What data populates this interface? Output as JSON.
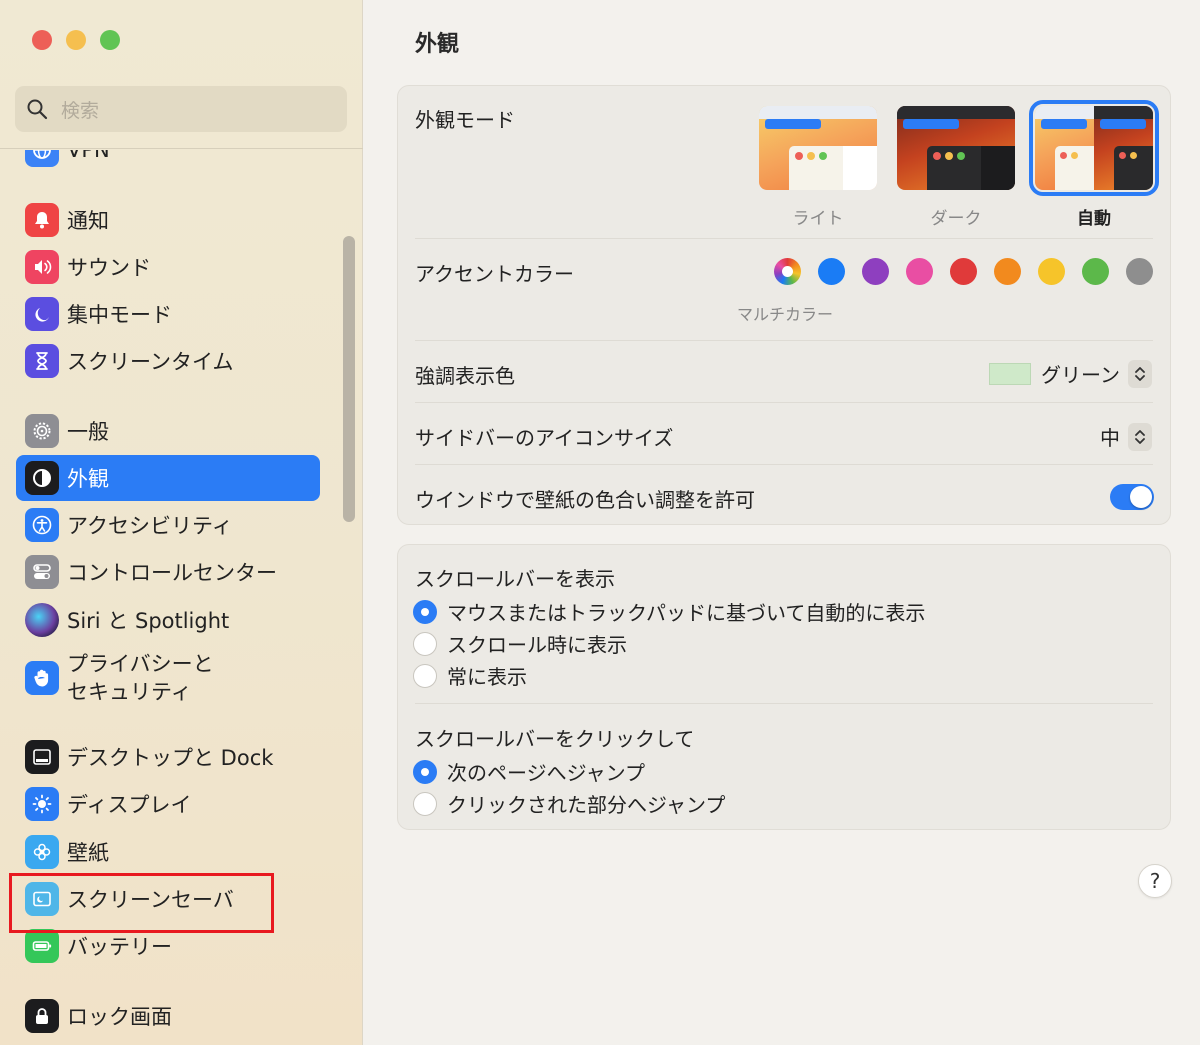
{
  "window": {
    "title": "外観"
  },
  "search": {
    "placeholder": "検索"
  },
  "sidebar": {
    "items": [
      {
        "label": "VPN",
        "icon": "globe-icon",
        "color": "#3b82f6"
      },
      {
        "label": "通知",
        "icon": "bell-icon",
        "color": "#ef4444"
      },
      {
        "label": "サウンド",
        "icon": "speaker-icon",
        "color": "#ef4461"
      },
      {
        "label": "集中モード",
        "icon": "moon-icon",
        "color": "#5b4ee0"
      },
      {
        "label": "スクリーンタイム",
        "icon": "hourglass-icon",
        "color": "#5b4ee0"
      },
      {
        "label": "一般",
        "icon": "gear-icon",
        "color": "#8e8e93"
      },
      {
        "label": "外観",
        "icon": "appearance-icon",
        "color": "#1c1c1e"
      },
      {
        "label": "アクセシビリティ",
        "icon": "accessibility-icon",
        "color": "#2b7cf5"
      },
      {
        "label": "コントロールセンター",
        "icon": "toggles-icon",
        "color": "#8e8e93"
      },
      {
        "label": "Siri と Spotlight",
        "icon": "siri-icon",
        "color": "#6b3fa0"
      },
      {
        "label": "プライバシーと\nセキュリティ",
        "icon": "hand-icon",
        "color": "#2b7cf5"
      },
      {
        "label": "デスクトップと Dock",
        "icon": "dock-icon",
        "color": "#1c1c1e"
      },
      {
        "label": "ディスプレイ",
        "icon": "brightness-icon",
        "color": "#2b7cf5"
      },
      {
        "label": "壁紙",
        "icon": "flower-icon",
        "color": "#3aa8f0"
      },
      {
        "label": "スクリーンセーバ",
        "icon": "screensaver-icon",
        "color": "#4fb6e8"
      },
      {
        "label": "バッテリー",
        "icon": "battery-icon",
        "color": "#34c759"
      },
      {
        "label": "ロック画面",
        "icon": "lock-icon",
        "color": "#1c1c1e"
      }
    ]
  },
  "appearance": {
    "mode_label": "外観モード",
    "modes": [
      {
        "label": "ライト"
      },
      {
        "label": "ダーク"
      },
      {
        "label": "自動"
      }
    ],
    "selected_mode": "自動",
    "accent_label": "アクセントカラー",
    "accent_colors": [
      "multicolor",
      "#1a7cf5",
      "#8e3fbf",
      "#e94ea3",
      "#e03a3a",
      "#f28a1e",
      "#f6c42a",
      "#5cb84a",
      "#8e8e8e"
    ],
    "accent_selected_label": "マルチカラー",
    "highlight_label": "強調表示色",
    "highlight_value": "グリーン",
    "highlight_color": "#cfe9c9",
    "icon_size_label": "サイドバーのアイコンサイズ",
    "icon_size_value": "中",
    "tint_label": "ウインドウで壁紙の色合い調整を許可",
    "tint_enabled": true
  },
  "scrollbars": {
    "show_label": "スクロールバーを表示",
    "show_options": [
      {
        "label": "マウスまたはトラックパッドに基づいて自動的に表示",
        "selected": true
      },
      {
        "label": "スクロール時に表示",
        "selected": false
      },
      {
        "label": "常に表示",
        "selected": false
      }
    ],
    "click_label": "スクロールバーをクリックして",
    "click_options": [
      {
        "label": "次のページへジャンプ",
        "selected": true
      },
      {
        "label": "クリックされた部分へジャンプ",
        "selected": false
      }
    ]
  },
  "help": {
    "label": "?"
  },
  "colors": {
    "accent": "#2b7cf5",
    "annotation": "#e8191f"
  }
}
